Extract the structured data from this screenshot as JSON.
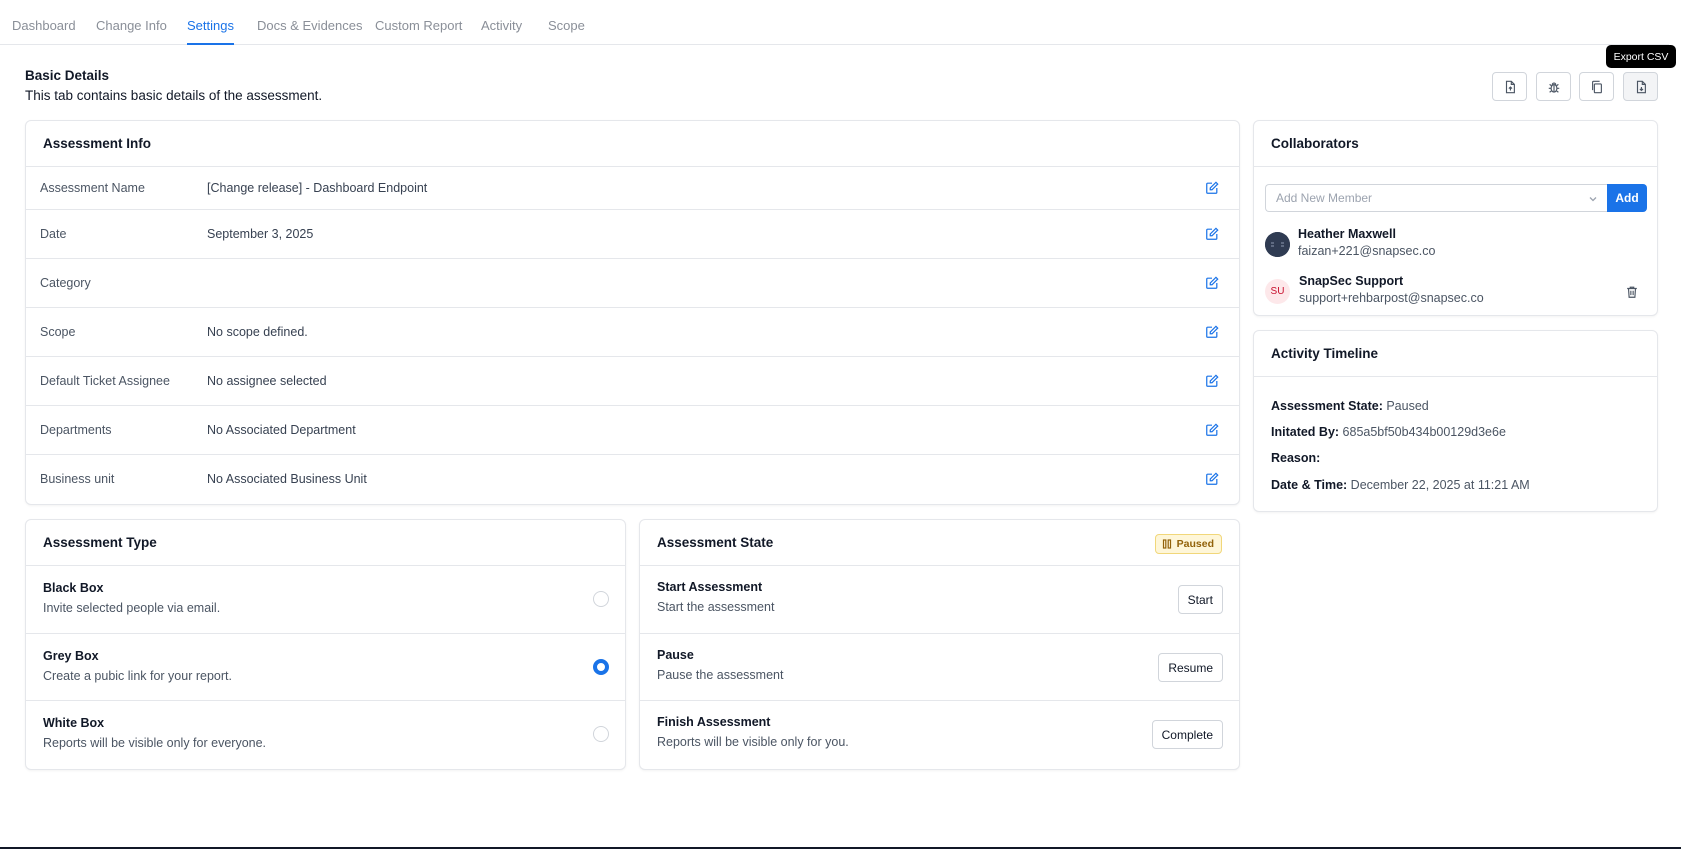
{
  "tabs": [
    {
      "label": "Dashboard"
    },
    {
      "label": "Change Info"
    },
    {
      "label": "Settings"
    },
    {
      "label": "Docs & Evidences"
    },
    {
      "label": "Custom Report"
    },
    {
      "label": "Activity"
    },
    {
      "label": "Scope"
    }
  ],
  "header": {
    "title": "Basic Details",
    "subtitle": "This tab contains basic details of the assessment.",
    "tooltip": "Export CSV",
    "toolbar_icons": [
      "file-upload-icon",
      "bug-icon",
      "copy-icon",
      "export-csv-icon"
    ]
  },
  "assessment_info": {
    "title": "Assessment Info",
    "rows": [
      {
        "label": "Assessment Name",
        "value": "[Change release] - Dashboard Endpoint"
      },
      {
        "label": "Date",
        "value": "September 3, 2025"
      },
      {
        "label": "Category",
        "value": ""
      },
      {
        "label": "Scope",
        "value": "No scope defined."
      },
      {
        "label": "Default Ticket Assignee",
        "value": "No assignee selected"
      },
      {
        "label": "Departments",
        "value": "No Associated Department"
      },
      {
        "label": "Business unit",
        "value": "No Associated Business Unit"
      }
    ]
  },
  "assessment_type": {
    "title": "Assessment Type",
    "options": [
      {
        "title": "Black Box",
        "desc": "Invite selected people via email.",
        "selected": false
      },
      {
        "title": "Grey Box",
        "desc": "Create a pubic link for your report.",
        "selected": true
      },
      {
        "title": "White Box",
        "desc": "Reports will be visible only for everyone.",
        "selected": false
      }
    ]
  },
  "assessment_state": {
    "title": "Assessment State",
    "badge": "Paused",
    "rows": [
      {
        "title": "Start Assessment",
        "desc": "Start the assessment",
        "button": "Start"
      },
      {
        "title": "Pause",
        "desc": "Pause the assessment",
        "button": "Resume"
      },
      {
        "title": "Finish Assessment",
        "desc": "Reports will be visible only for you.",
        "button": "Complete"
      }
    ]
  },
  "collaborators": {
    "title": "Collaborators",
    "placeholder": "Add New Member",
    "add_label": "Add",
    "members": [
      {
        "name": "Heather Maxwell",
        "email": "faizan+221@snapsec.co",
        "initials": ""
      },
      {
        "name": "SnapSec Support",
        "email": "support+rehbarpost@snapsec.co",
        "initials": "SU"
      }
    ]
  },
  "timeline": {
    "title": "Activity Timeline",
    "lines": [
      {
        "label": "Assessment State:",
        "value": "Paused"
      },
      {
        "label": "Initated By:",
        "value": "685a5bf50b434b00129d3e6e"
      },
      {
        "label": "Reason:",
        "value": ""
      },
      {
        "label": "Date & Time:",
        "value": "December 22, 2025 at 11:21 AM"
      }
    ]
  },
  "colors": {
    "accent": "#1a73e8",
    "paused_badge_bg": "#fef6d8",
    "paused_badge_text": "#92620a",
    "su_avatar_bg": "#fde8ea"
  }
}
